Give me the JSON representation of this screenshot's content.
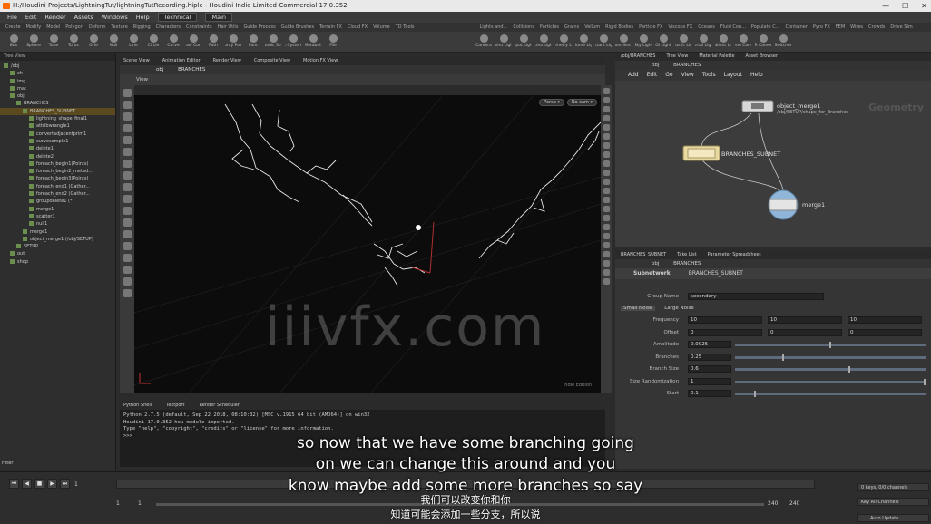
{
  "window": {
    "title": "H:/Houdini Projects/LightningTut/lightningTutRecording.hiplc - Houdini Indie Limited-Commercial 17.0.352"
  },
  "menubar": {
    "items": [
      "File",
      "Edit",
      "Render",
      "Assets",
      "Windows",
      "Help"
    ],
    "desktop": "Technical",
    "main": "Main"
  },
  "shelf": {
    "tabs": [
      "Create",
      "Modify",
      "Model",
      "Polygon",
      "Deform",
      "Texture",
      "Rigging",
      "Characters",
      "Constraints",
      "Hair Utils",
      "Guide Process",
      "Guide Brushes",
      "Terrain FX",
      "Cloud FX",
      "Volume",
      "TD Tools"
    ],
    "tools": [
      "Box",
      "Sphere",
      "Tube",
      "Torus",
      "Grid",
      "Null",
      "Line",
      "Circle",
      "Curve",
      "Draw Curve",
      "Path",
      "Spray Paint",
      "Font",
      "Platonic Solids",
      "L-System",
      "Metaball",
      "File"
    ],
    "right_tabs": [
      "Lights and...",
      "Collisions",
      "Particles",
      "Grains",
      "Vellum",
      "Rigid Bodies",
      "Particle FX",
      "Viscous FX",
      "Oceans",
      "Fluid Con...",
      "Populate C...",
      "Container",
      "Pyro FX",
      "FEM",
      "Wires",
      "Crowds",
      "Drive Sim"
    ],
    "right_tools": [
      "Camera",
      "Point Light",
      "Spot Light",
      "Area Light",
      "Geometry Light",
      "Volume Light",
      "Distant Light",
      "Environment Light",
      "Sky Light",
      "GI Light",
      "Caustic Light",
      "Portal Light",
      "Ambient Light",
      "Stereo Camera",
      "VR Camera",
      "Switcher"
    ]
  },
  "left_pane": {
    "tabs": "Tree View",
    "rows": [
      {
        "label": "/obj",
        "indent": 0,
        "selected": false
      },
      {
        "label": "ch",
        "indent": 1,
        "selected": false
      },
      {
        "label": "img",
        "indent": 1,
        "selected": false
      },
      {
        "label": "mat",
        "indent": 1,
        "selected": false
      },
      {
        "label": "obj",
        "indent": 1,
        "selected": false
      },
      {
        "label": "BRANCHES",
        "indent": 2,
        "selected": false
      },
      {
        "label": "BRANCHES_SUBNET",
        "indent": 3,
        "selected": true
      },
      {
        "label": "lightning_shape_final1",
        "indent": 4,
        "selected": false
      },
      {
        "label": "attribwrangle1",
        "indent": 4,
        "selected": false
      },
      {
        "label": "convertadjacentprim1",
        "indent": 4,
        "selected": false
      },
      {
        "label": "curvesample1",
        "indent": 4,
        "selected": false
      },
      {
        "label": "delete1",
        "indent": 4,
        "selected": false
      },
      {
        "label": "delete2",
        "indent": 4,
        "selected": false
      },
      {
        "label": "foreach_begin1(Points)",
        "indent": 4,
        "selected": false
      },
      {
        "label": "foreach_begin2_metad...",
        "indent": 4,
        "selected": false
      },
      {
        "label": "foreach_begin3(Points)",
        "indent": 4,
        "selected": false
      },
      {
        "label": "foreach_end1 (Gather...",
        "indent": 4,
        "selected": false
      },
      {
        "label": "foreach_end2 (Gather...",
        "indent": 4,
        "selected": false
      },
      {
        "label": "groupdelete1 (*)",
        "indent": 4,
        "selected": false
      },
      {
        "label": "merge1",
        "indent": 4,
        "selected": false
      },
      {
        "label": "scatter1",
        "indent": 4,
        "selected": false
      },
      {
        "label": "null1",
        "indent": 4,
        "selected": false
      },
      {
        "label": "merge1",
        "indent": 3,
        "selected": false
      },
      {
        "label": "object_merge1 (/obj/SETUP)",
        "indent": 3,
        "selected": false
      },
      {
        "label": "SETUP",
        "indent": 2,
        "selected": false
      },
      {
        "label": "out",
        "indent": 1,
        "selected": false
      },
      {
        "label": "shop",
        "indent": 1,
        "selected": false
      }
    ],
    "filter_label": "Filter"
  },
  "viewport": {
    "tabs": [
      "Scene View",
      "Animation Editor",
      "Render View",
      "Composite View",
      "Motion FX View"
    ],
    "path_obj": "obj",
    "path_node": "BRANCHES",
    "view_label": "View",
    "persp": "Persp ▾",
    "cam": "No cam ▾",
    "corner_label": "Indie Edition"
  },
  "python": {
    "tabs": [
      "Python Shell",
      "Textport",
      "Render Scheduler"
    ],
    "lines": "Python 2.7.5 (default, Sep 22 2018, 08:10:32) [MSC v.1915 64 bit (AMD64)] on win32\nHoudini 17.0.352 hou module imported.\nType \"help\", \"copyright\", \"credits\" or \"license\" for more information.\n>>>"
  },
  "network": {
    "tabs": [
      "/obj/BRANCHES",
      "Tree View",
      "Material Palette",
      "Asset Browser"
    ],
    "path_obj": "obj",
    "path_node": "BRANCHES",
    "menu": [
      "Add",
      "Edit",
      "Go",
      "View",
      "Tools",
      "Layout",
      "Help"
    ],
    "context_label": "Geometry",
    "nodes": {
      "object_merge": {
        "name": "object_merge1",
        "sub": "/obj/SETUP/shape_for_Branches"
      },
      "subnet": {
        "name": "BRANCHES_SUBNET"
      },
      "merge": {
        "name": "merge1"
      }
    }
  },
  "parms": {
    "tabs": [
      "BRANCHES_SUBNET",
      "Take List",
      "Parameter Spreadsheet"
    ],
    "path_obj": "obj",
    "path_node": "BRANCHES",
    "node_type": "Subnetwork",
    "node_name": "BRANCHES_SUBNET",
    "group_name_label": "Group Name",
    "group_name_value": "secondary",
    "folder_tabs": [
      "Small Noise",
      "Large Noise"
    ],
    "rows": [
      {
        "label": "Frequency",
        "vec": [
          "10",
          "10",
          "10"
        ]
      },
      {
        "label": "Offset",
        "vec": [
          "0",
          "0",
          "0"
        ]
      },
      {
        "label": "Amplitude",
        "value": "0.0025",
        "fraction": 0.5
      },
      {
        "label": "Branches",
        "value": "0.25",
        "fraction": 0.25
      },
      {
        "label": "Branch Size",
        "value": "0.6",
        "fraction": 0.6
      },
      {
        "label": "Size Randomization",
        "value": "1",
        "fraction": 1.0
      },
      {
        "label": "Start",
        "value": "0.1",
        "fraction": 0.1
      }
    ]
  },
  "timeline": {
    "frame": "1",
    "start": "1",
    "start2": "1",
    "end": "240",
    "end2": "240",
    "key_label": "0 keys, 0/0 channels",
    "key_all": "Key All Channels",
    "auto_update": "Auto Update"
  },
  "overlay": {
    "watermark": "iiivfx.com",
    "subtitle_en_1": "so now that we have some branching going",
    "subtitle_en_2": "on we can change this around and you",
    "subtitle_en_3": "know maybe add some more branches so say",
    "subtitle_cn_1": "我们可以改变你和你",
    "subtitle_cn_2": "知道可能会添加一些分支，所以说"
  },
  "colors": {
    "selected_row": "#5a4a1e",
    "node_link": "#c8c8c8",
    "handle_red": "#b03030"
  }
}
